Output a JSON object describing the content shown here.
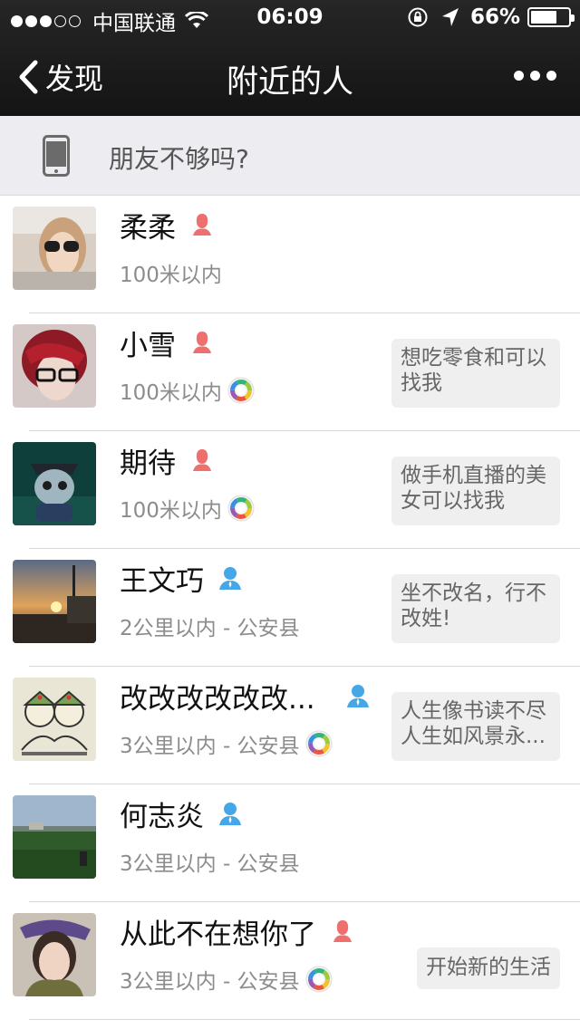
{
  "status_bar": {
    "carrier": "中国联通",
    "time": "06:09",
    "battery": "66%",
    "battery_level": 0.66,
    "signal_bars_filled": 3,
    "signal_bars_total": 5
  },
  "nav": {
    "back_label": "发现",
    "title": "附近的人"
  },
  "banner": {
    "text": "朋友不够吗?"
  },
  "colors": {
    "female": "#ef6f6f",
    "male": "#45a6e8",
    "nav_bg": "#1c1c1c"
  },
  "people": [
    {
      "name": "柔柔",
      "gender": "female",
      "distance": "100米以内",
      "moments": false,
      "signature": ""
    },
    {
      "name": "小雪",
      "gender": "female",
      "distance": "100米以内",
      "moments": true,
      "signature": "想吃零食和可以找我"
    },
    {
      "name": "期待",
      "gender": "female",
      "distance": "100米以内",
      "moments": true,
      "signature": "做手机直播的美女可以找我"
    },
    {
      "name": "王文巧",
      "gender": "male",
      "distance": "2公里以内 - 公安县",
      "moments": false,
      "signature": "坐不改名，行不改姓!"
    },
    {
      "name": "改改改改改改...",
      "gender": "male",
      "distance": "3公里以内 - 公安县",
      "moments": true,
      "signature": "人生像书读不尽人生如风景永..."
    },
    {
      "name": "何志炎",
      "gender": "male",
      "distance": "3公里以内 - 公安县",
      "moments": false,
      "signature": ""
    },
    {
      "name": "从此不在想你了",
      "gender": "female",
      "distance": "3公里以内 - 公安县",
      "moments": true,
      "signature": "开始新的生活"
    }
  ]
}
